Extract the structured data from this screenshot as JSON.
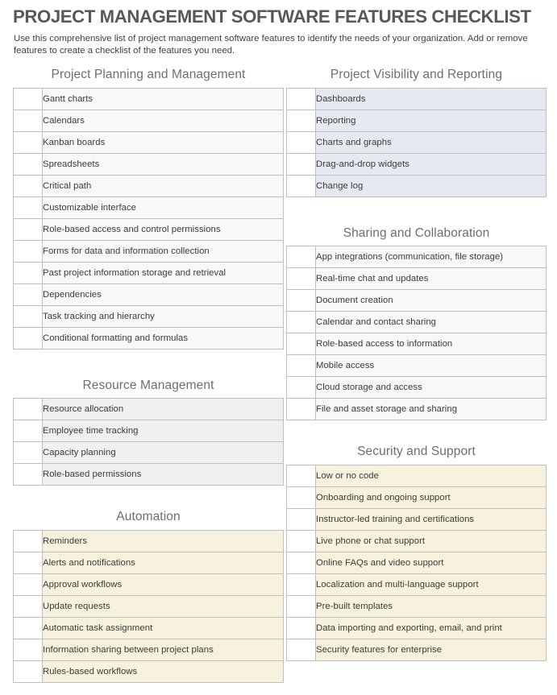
{
  "document": {
    "title": "PROJECT MANAGEMENT SOFTWARE FEATURES CHECKLIST",
    "subtitle": "Use this comprehensive list of project management software features to identify the needs of your organization. Add or remove features to create a checklist of the features you need."
  },
  "colors": {
    "title_text": "#58585a",
    "section_heading": "#6d6e71",
    "body_text": "#3a3a3a",
    "cell_border": "#bfbfbf",
    "theme_plain": "#f7f8f9",
    "theme_gray": "#f0f0f0",
    "theme_blue": "#e6eaf0",
    "theme_cream": "#f7f2dd",
    "checkbox_cell": "#ffffff"
  },
  "sections": {
    "project_planning": {
      "title": "Project Planning and Management",
      "theme": "plain",
      "items": [
        "Gantt charts",
        "Calendars",
        "Kanban boards",
        "Spreadsheets",
        "Critical path",
        "Customizable interface",
        "Role-based access and control permissions",
        "Forms for data and information collection",
        "Past project information storage and retrieval",
        "Dependencies",
        "Task tracking and hierarchy",
        "Conditional formatting and formulas"
      ]
    },
    "resource_management": {
      "title": "Resource Management",
      "theme": "gray",
      "items": [
        "Resource allocation",
        "Employee time tracking",
        "Capacity planning",
        "Role-based permissions"
      ]
    },
    "automation": {
      "title": "Automation",
      "theme": "cream",
      "items": [
        "Reminders",
        "Alerts and notifications",
        "Approval workflows",
        "Update requests",
        "Automatic task assignment",
        "Information sharing between project plans",
        "Rules-based workflows"
      ]
    },
    "project_visibility": {
      "title": "Project Visibility and Reporting",
      "theme": "blue",
      "items": [
        "Dashboards",
        "Reporting",
        "Charts and graphs",
        "Drag-and-drop widgets",
        "Change log"
      ]
    },
    "sharing_collaboration": {
      "title": "Sharing and Collaboration",
      "theme": "plain",
      "items": [
        "App integrations (communication, file storage)",
        "Real-time chat and updates",
        "Document creation",
        "Calendar and contact sharing",
        "Role-based access to information",
        "Mobile access",
        "Cloud storage and access",
        "File and asset storage and sharing"
      ]
    },
    "security_support": {
      "title": "Security and Support",
      "theme": "cream",
      "items": [
        "Low or no code",
        "Onboarding and ongoing support",
        "Instructor-led training and certifications",
        "Live phone or chat support",
        "Online FAQs and video support",
        "Localization and multi-language support",
        "Pre-built templates",
        "Data importing and exporting, email, and print",
        "Security features for enterprise"
      ]
    }
  }
}
